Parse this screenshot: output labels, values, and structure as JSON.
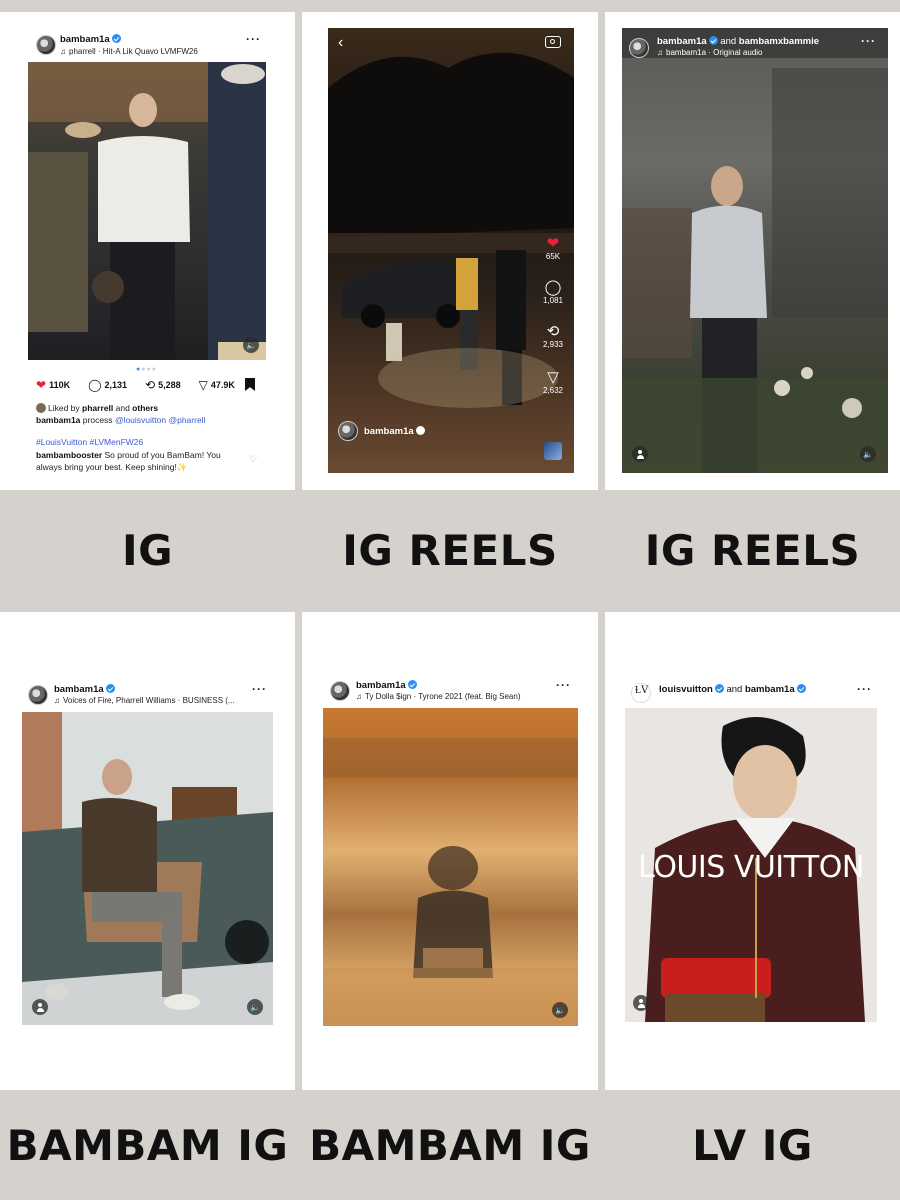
{
  "panels": [
    {
      "caption": "IG",
      "username": "bambam1a",
      "audio": "pharrell · Hit-A Lik Quavo LVMFW26",
      "likes": "110K",
      "comments": "2,131",
      "reposts": "5,288",
      "shares": "47.9K",
      "liked_by_prefix": "Liked by",
      "liked_by_user": "pharrell",
      "liked_by_suffix": "and",
      "liked_by_others": "others",
      "caption_user": "bambam1a",
      "caption_text": "process",
      "mention1": "@louisvuitton",
      "mention2": "@pharrell",
      "hashtags": "#LouisVuitton #LVMenFW26",
      "comment_user": "bambambooster",
      "comment_text": "So proud of you BamBam! You always bring your best. Keep shining!✨"
    },
    {
      "caption": "IG REELS",
      "username": "bambam1a",
      "likes": "65K",
      "comments": "1,081",
      "reposts": "2,933",
      "shares": "2,632"
    },
    {
      "caption": "IG REELS",
      "username": "bambam1a",
      "and_text": "and",
      "collab": "bambamxbammie",
      "audio": "bambam1a · Original audio"
    },
    {
      "caption": "BAMBAM IG",
      "username": "bambam1a",
      "audio": "Voices of Fire, Pharrell Williams · BUSINESS (..."
    },
    {
      "caption": "BAMBAM IG",
      "username": "bambam1a",
      "audio": "Ty Dolla $ign · Tyrone 2021 (feat. Big Sean)"
    },
    {
      "caption": "LV IG",
      "username": "louisvuitton",
      "and_text": "and",
      "collab": "bambam1a",
      "brand_overlay": "LOUIS VUITTON"
    }
  ],
  "colors": {
    "background": "#d5d1cd",
    "card": "#ffffff",
    "verified": "#2b8ef0",
    "link": "#3b5bd6",
    "heart": "#e8213d"
  },
  "icons": [
    "verified-icon",
    "music-note-icon",
    "more-icon",
    "heart-icon",
    "comment-icon",
    "repost-icon",
    "share-icon",
    "bookmark-icon",
    "sound-icon",
    "user-tag-icon",
    "back-icon",
    "camera-icon"
  ]
}
